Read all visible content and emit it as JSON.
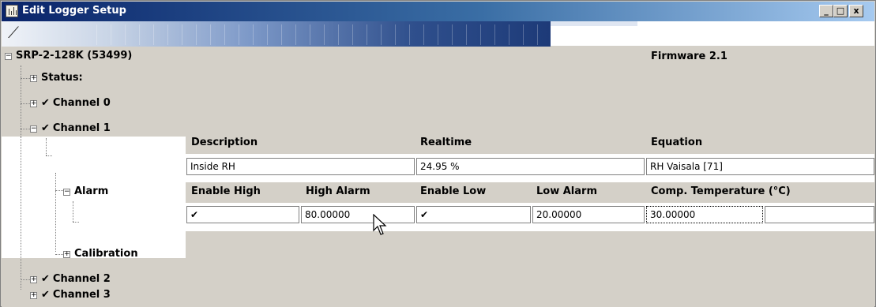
{
  "window": {
    "title": "Edit Logger Setup",
    "minimize": "_",
    "maximize": "□",
    "close": "x"
  },
  "device": {
    "name": "SRP-2-128K (53499)",
    "firmware": "Firmware 2.1"
  },
  "tree": {
    "status": "Status:",
    "channel0": "Channel 0",
    "channel1": "Channel 1",
    "alarm": "Alarm",
    "calibration": "Calibration",
    "channel2": "Channel 2",
    "channel3": "Channel 3",
    "checkmark": "✔",
    "plus": "+",
    "minus": "−"
  },
  "channel1": {
    "headers": {
      "description": "Description",
      "realtime": "Realtime",
      "equation": "Equation"
    },
    "description": "Inside RH",
    "realtime": "24.95 %",
    "equation": "RH Vaisala  [71]"
  },
  "alarm": {
    "headers": {
      "enable_high": "Enable High",
      "high_alarm": "High Alarm",
      "enable_low": "Enable Low",
      "low_alarm": "Low Alarm",
      "comp_temp": "Comp. Temperature (°C)"
    },
    "enable_high": "✔",
    "high_alarm": "80.00000",
    "enable_low": "✔",
    "low_alarm": "20.00000",
    "comp_temp": "30.00000"
  }
}
